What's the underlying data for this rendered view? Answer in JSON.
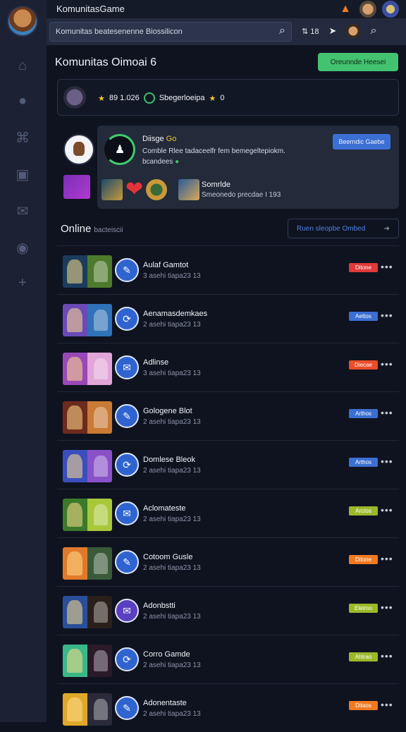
{
  "app": {
    "title": "KomunitasGame"
  },
  "search": {
    "placeholder": "Komunitas beatesenenne Biossilicon"
  },
  "topbar_counter": "18",
  "page": {
    "title": "Komunitas Oimoai 6",
    "create_label": "Oreunnde Heesei"
  },
  "stats": {
    "score": "89 1.026",
    "label": "Sbegerloeipa",
    "stars": "0"
  },
  "profile": {
    "name": "Diisge",
    "name_accent": "Go",
    "desc": "Comble Rlee tadaceelfr fem bemegeltepiokm.",
    "desc_suffix": "bcandees",
    "action_label": "Beerndic Gaebe",
    "sub_label": "Somrlde",
    "sub_meta": "Smeonedo precdae I 193"
  },
  "online": {
    "title": "Online",
    "subtitle": "bacteiscii",
    "button_label": "Ruen sleopbe Ombed"
  },
  "players": [
    {
      "name": "Aulaf Gamtot",
      "meta": "3 asehi tiapa23 13",
      "tag": "Ditone",
      "tag_color": "#e03a3a",
      "thumb": [
        "#1b3c5c",
        "#4d7a2c"
      ]
    },
    {
      "name": "Aenamasdemkaes",
      "meta": "2 asehi tiapa23 13",
      "tag": "Aettos",
      "tag_color": "#3b6fd2",
      "thumb": [
        "#6b4ab8",
        "#2f72b8"
      ]
    },
    {
      "name": "Adlinse",
      "meta": "3 asehi tiapa23 13",
      "tag": "Diecae",
      "tag_color": "#ea4d2a",
      "thumb": [
        "#9a48b8",
        "#e2a5d8"
      ]
    },
    {
      "name": "Gologene Blot",
      "meta": "2 asehi tiapa23 13",
      "tag": "Arthos",
      "tag_color": "#3b6fd2",
      "thumb": [
        "#6e2a1c",
        "#c97a35"
      ]
    },
    {
      "name": "Domlese Bleok",
      "meta": "2 asehi tiapa23 13",
      "tag": "Arthos",
      "tag_color": "#3b6fd2",
      "thumb": [
        "#3a4fbd",
        "#8a52c8"
      ]
    },
    {
      "name": "Aclomateste",
      "meta": "2 asehi tiapa23 13",
      "tag": "Arctos",
      "tag_color": "#9cb82a",
      "thumb": [
        "#3a7a2a",
        "#a8c83a"
      ]
    },
    {
      "name": "Cotoom Gusle",
      "meta": "2 asehi tiapa23 13",
      "tag": "Ditone",
      "tag_color": "#f07a22",
      "thumb": [
        "#e07a2a",
        "#3a5a3a"
      ]
    },
    {
      "name": "Adonbstti",
      "meta": "2 asehi tiapa23 13",
      "tag": "Eletmo",
      "tag_color": "#9cb82a",
      "thumb": [
        "#2a4f9a",
        "#2a1f1a"
      ]
    },
    {
      "name": "Corro Gamde",
      "meta": "2 asehi tiapa23 13",
      "tag": "Ahtrao",
      "tag_color": "#9cb82a",
      "thumb": [
        "#3ab888",
        "#2a1a2a"
      ]
    },
    {
      "name": "Adonentaste",
      "meta": "2 asehi tiapa23 13",
      "tag": "Ditaos",
      "tag_color": "#f07a22",
      "thumb": [
        "#e0a82a",
        "#2a2a3a"
      ]
    }
  ],
  "colors": {
    "accent_green": "#43c26f",
    "accent_blue": "#3c6fd4",
    "panel": "#232a3a",
    "background": "#0f1320",
    "sidebar": "#1c2233"
  },
  "icons": {
    "rail": [
      "home-icon",
      "chat-icon",
      "gamepad-icon",
      "inbox-icon",
      "mail-icon",
      "heart-icon",
      "plus-icon"
    ]
  }
}
